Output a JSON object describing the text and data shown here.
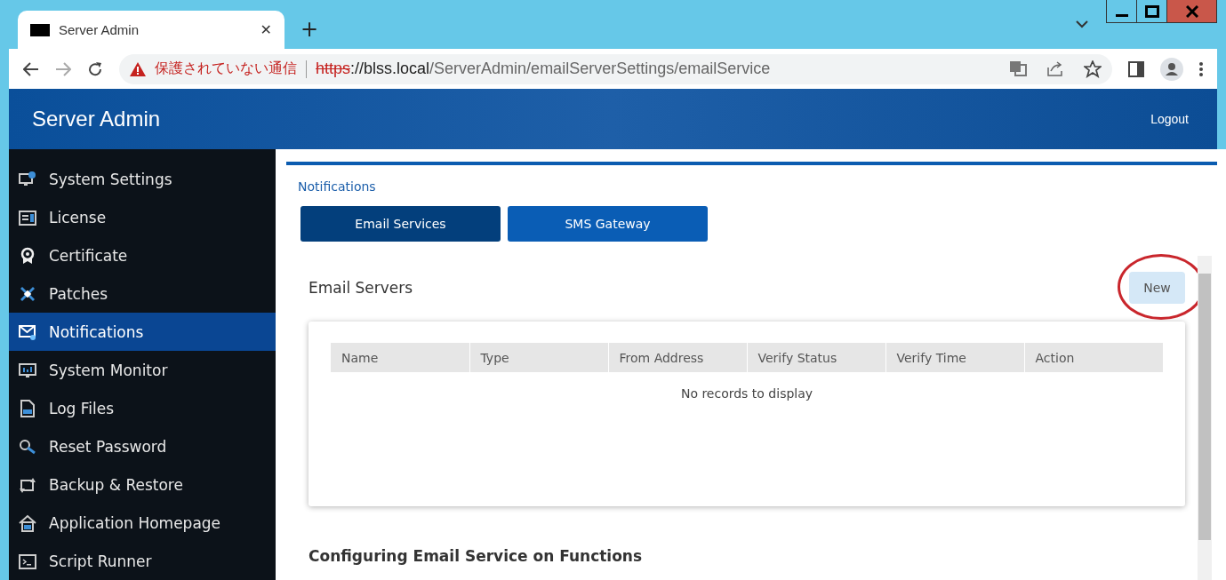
{
  "browser": {
    "tab_title": "Server Admin",
    "close_tab": "✕",
    "new_tab": "+",
    "security_warning": "保護されていない通信",
    "url_scheme": "https",
    "url_host": "://blss.local",
    "url_path": "/ServerAdmin/emailServerSettings/emailService"
  },
  "header": {
    "title": "Server Admin",
    "logout": "Logout"
  },
  "sidebar": {
    "items": [
      {
        "label": "System Settings",
        "selected": false
      },
      {
        "label": "License",
        "selected": false
      },
      {
        "label": "Certificate",
        "selected": false
      },
      {
        "label": "Patches",
        "selected": false
      },
      {
        "label": "Notifications",
        "selected": true
      },
      {
        "label": "System Monitor",
        "selected": false
      },
      {
        "label": "Log Files",
        "selected": false
      },
      {
        "label": "Reset Password",
        "selected": false
      },
      {
        "label": "Backup & Restore",
        "selected": false
      },
      {
        "label": "Application Homepage",
        "selected": false
      },
      {
        "label": "Script Runner",
        "selected": false
      }
    ]
  },
  "content": {
    "breadcrumb": "Notifications",
    "tabs": [
      {
        "label": "Email Services",
        "selected": true
      },
      {
        "label": "SMS Gateway",
        "selected": false
      }
    ],
    "section_title": "Email Servers",
    "new_button": "New",
    "table": {
      "columns": [
        "Name",
        "Type",
        "From Address",
        "Verify Status",
        "Verify Time",
        "Action"
      ],
      "empty_message": "No records to display"
    },
    "section2_title": "Configuring Email Service on Functions"
  }
}
